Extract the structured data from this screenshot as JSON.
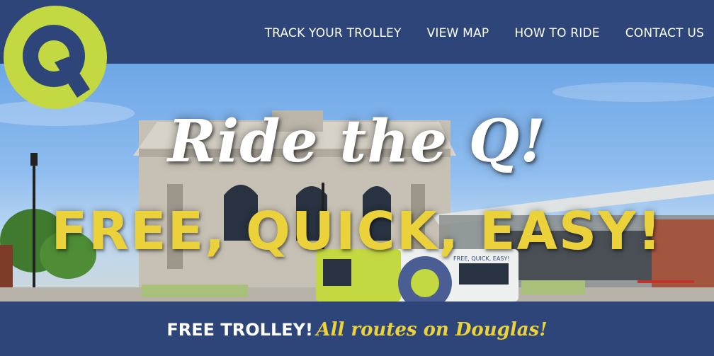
{
  "brand": {
    "logo_icon": "q-circle-logo",
    "primary_color": "#2d4578",
    "accent_color": "#c4d842",
    "headline_yellow": "#ecd23a"
  },
  "nav": {
    "items": [
      {
        "label": "TRACK YOUR TROLLEY"
      },
      {
        "label": "VIEW MAP"
      },
      {
        "label": "HOW TO RIDE"
      },
      {
        "label": "CONTACT US"
      }
    ]
  },
  "hero": {
    "title": "Ride the Q!",
    "subtitle": "FREE, QUICK, EASY!",
    "trolley_sign": "FREE, QUICK, EASY!"
  },
  "footer": {
    "lead": "FREE TROLLEY!",
    "tagline": "All routes on Douglas!"
  }
}
